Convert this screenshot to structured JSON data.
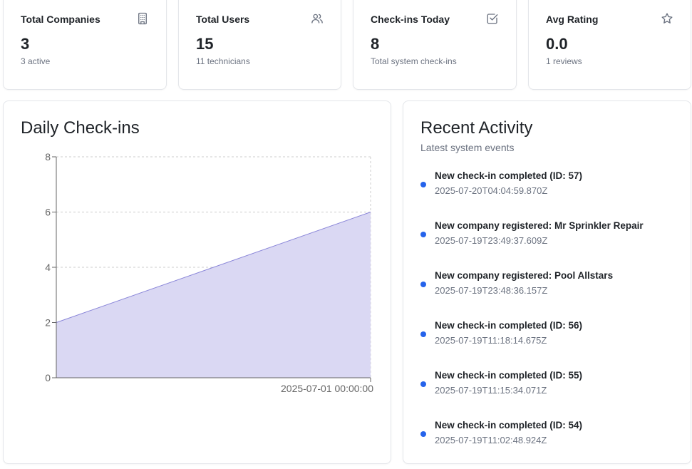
{
  "stats": [
    {
      "title": "Total Companies",
      "value": "3",
      "sub": "3 active",
      "icon": "building-icon"
    },
    {
      "title": "Total Users",
      "value": "15",
      "sub": "11 technicians",
      "icon": "users-icon"
    },
    {
      "title": "Check-ins Today",
      "value": "8",
      "sub": "Total system check-ins",
      "icon": "check-square-icon"
    },
    {
      "title": "Avg Rating",
      "value": "0.0",
      "sub": "1 reviews",
      "icon": "star-icon"
    }
  ],
  "chart_panel": {
    "title": "Daily Check-ins"
  },
  "chart_data": {
    "type": "area",
    "title": "Daily Check-ins",
    "xlabel": "",
    "ylabel": "",
    "x": [
      "",
      "2025-07-01 00:00:00"
    ],
    "values": [
      2,
      6
    ],
    "ylim": [
      0,
      8
    ],
    "yticks": [
      "0",
      "2",
      "4",
      "6",
      "8"
    ],
    "grid": true,
    "fill_color": "#dad8f3",
    "line_color": "#8884d8"
  },
  "activity_panel": {
    "title": "Recent Activity",
    "subtitle": "Latest system events",
    "dot_color": "#2563eb",
    "items": [
      {
        "text": "New check-in completed (ID: 57)",
        "time": "2025-07-20T04:04:59.870Z"
      },
      {
        "text": "New company registered: Mr Sprinkler Repair",
        "time": "2025-07-19T23:49:37.609Z"
      },
      {
        "text": "New company registered: Pool Allstars",
        "time": "2025-07-19T23:48:36.157Z"
      },
      {
        "text": "New check-in completed (ID: 56)",
        "time": "2025-07-19T11:18:14.675Z"
      },
      {
        "text": "New check-in completed (ID: 55)",
        "time": "2025-07-19T11:15:34.071Z"
      },
      {
        "text": "New check-in completed (ID: 54)",
        "time": "2025-07-19T11:02:48.924Z"
      }
    ]
  }
}
